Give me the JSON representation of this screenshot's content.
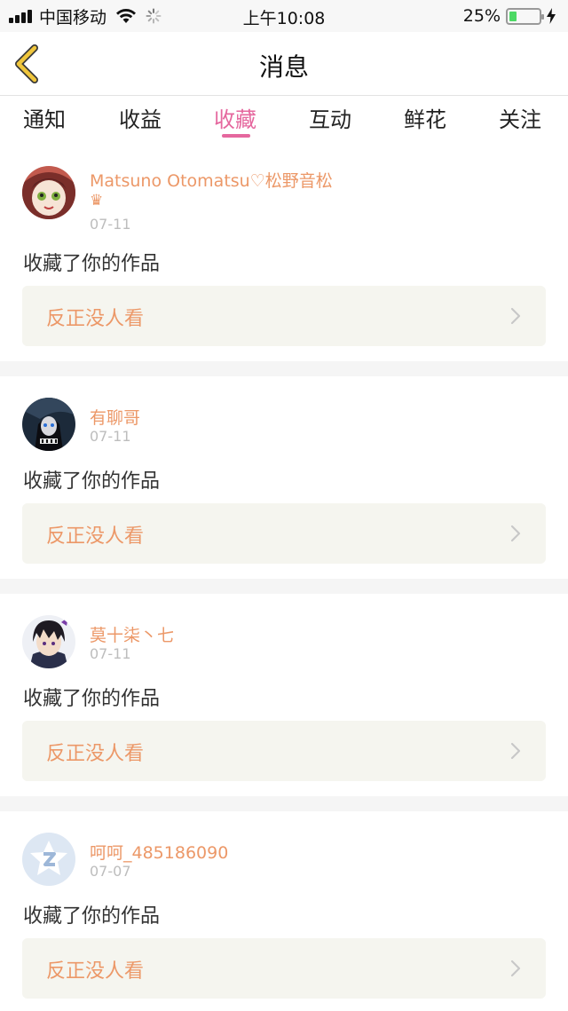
{
  "status_bar": {
    "carrier": "中国移动",
    "time": "上午10:08",
    "battery_percent": "25%",
    "battery_level": 0.25,
    "icons": [
      "signal-icon",
      "wifi-icon",
      "loading-spinner-icon",
      "battery-icon",
      "charging-bolt-icon"
    ]
  },
  "nav": {
    "title": "消息",
    "back_icon": "chevron-left-icon"
  },
  "tabs": [
    {
      "label": "通知",
      "active": false
    },
    {
      "label": "收益",
      "active": false
    },
    {
      "label": "收藏",
      "active": true
    },
    {
      "label": "互动",
      "active": false
    },
    {
      "label": "鲜花",
      "active": false
    },
    {
      "label": "关注",
      "active": false
    }
  ],
  "messages": [
    {
      "username": "Matsuno Otomatsu♡松野音松",
      "badge": "♛",
      "date": "07-11",
      "action": "收藏了你的作品",
      "work_title": "反正没人看",
      "avatar": "anime-girl-avatar"
    },
    {
      "username": "有聊哥",
      "date": "07-11",
      "action": "收藏了你的作品",
      "work_title": "反正没人看",
      "avatar": "dark-character-avatar"
    },
    {
      "username": "莫十柒丶七",
      "date": "07-11",
      "action": "收藏了你的作品",
      "work_title": "反正没人看",
      "avatar": "anime-boy-avatar"
    },
    {
      "username": "呵呵_485186090",
      "date": "07-07",
      "action": "收藏了你的作品",
      "work_title": "反正没人看",
      "avatar": "default-qq-avatar"
    }
  ],
  "colors": {
    "accent_pink": "#e5679e",
    "username_orange": "#ec9868",
    "back_arrow_yellow": "#f0c63c",
    "card_box_bg": "#f5f5ef",
    "divider_gray": "#f5f5f5"
  }
}
